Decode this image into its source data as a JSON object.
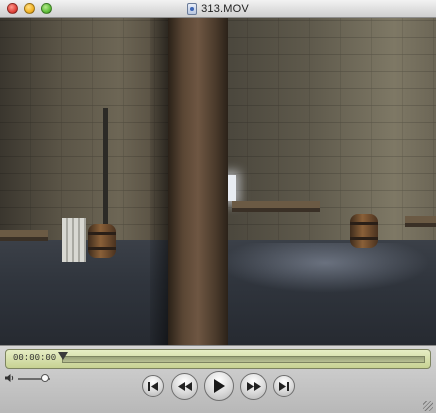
{
  "window": {
    "title": "313.MOV"
  },
  "controls": {
    "current_time": "00:00:00",
    "playback_position": 0,
    "volume_level": 0.85
  },
  "icons": {
    "close": "close-button",
    "minimize": "minimize-button",
    "zoom": "zoom-button",
    "document": "movie-document-icon",
    "volume": "speaker-icon",
    "go_to_start": "skip-back-icon",
    "rewind": "rewind-icon",
    "play": "play-icon",
    "fast_forward": "fast-forward-icon",
    "go_to_end": "skip-forward-icon"
  },
  "colors": {
    "timebar_bg": "#d8e0a8",
    "accent": "#3a3a3a"
  }
}
